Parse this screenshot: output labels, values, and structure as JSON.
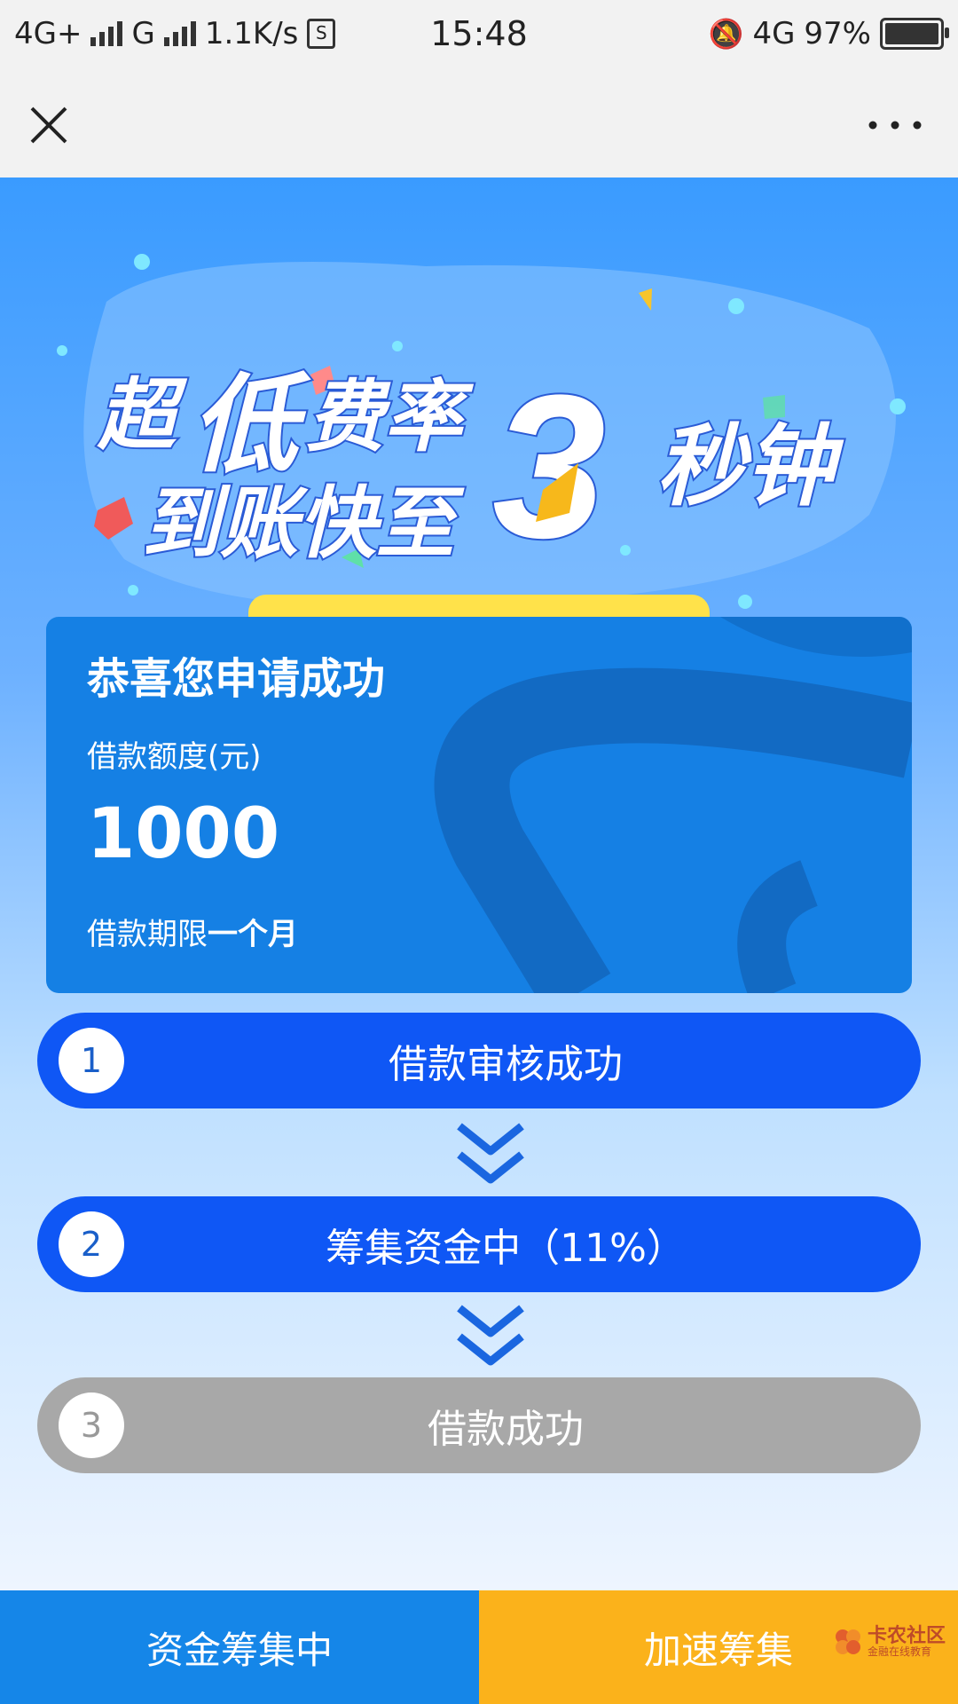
{
  "status_bar": {
    "network1": "4G+",
    "network2": "G",
    "speed": "1.1K/s",
    "time": "15:48",
    "network3": "4G",
    "battery": "97%"
  },
  "banner": {
    "line1_a": "超",
    "line1_b": "低",
    "line1_c": "费率",
    "line2": "到账快至",
    "big_number": "3",
    "line3": "秒钟"
  },
  "card": {
    "title": "恭喜您申请成功",
    "amount_label": "借款额度(元)",
    "amount": "1000",
    "term_label": "借款期限",
    "term_value": "一个月"
  },
  "steps": [
    {
      "num": "1",
      "label": "借款审核成功",
      "state": "active"
    },
    {
      "num": "2",
      "label": "筹集资金中（11%）",
      "state": "active"
    },
    {
      "num": "3",
      "label": "借款成功",
      "state": "disabled"
    }
  ],
  "bottom": {
    "left_label": "资金筹集中",
    "right_label": "加速筹集"
  },
  "watermark": {
    "main": "卡农社区",
    "sub": "金融在线教育"
  },
  "colors": {
    "step_active": "#0f57f5",
    "step_disabled": "#a8a8a8",
    "bottom_left": "#1586e8",
    "bottom_right": "#fbb21b",
    "card": "#1580e4"
  }
}
